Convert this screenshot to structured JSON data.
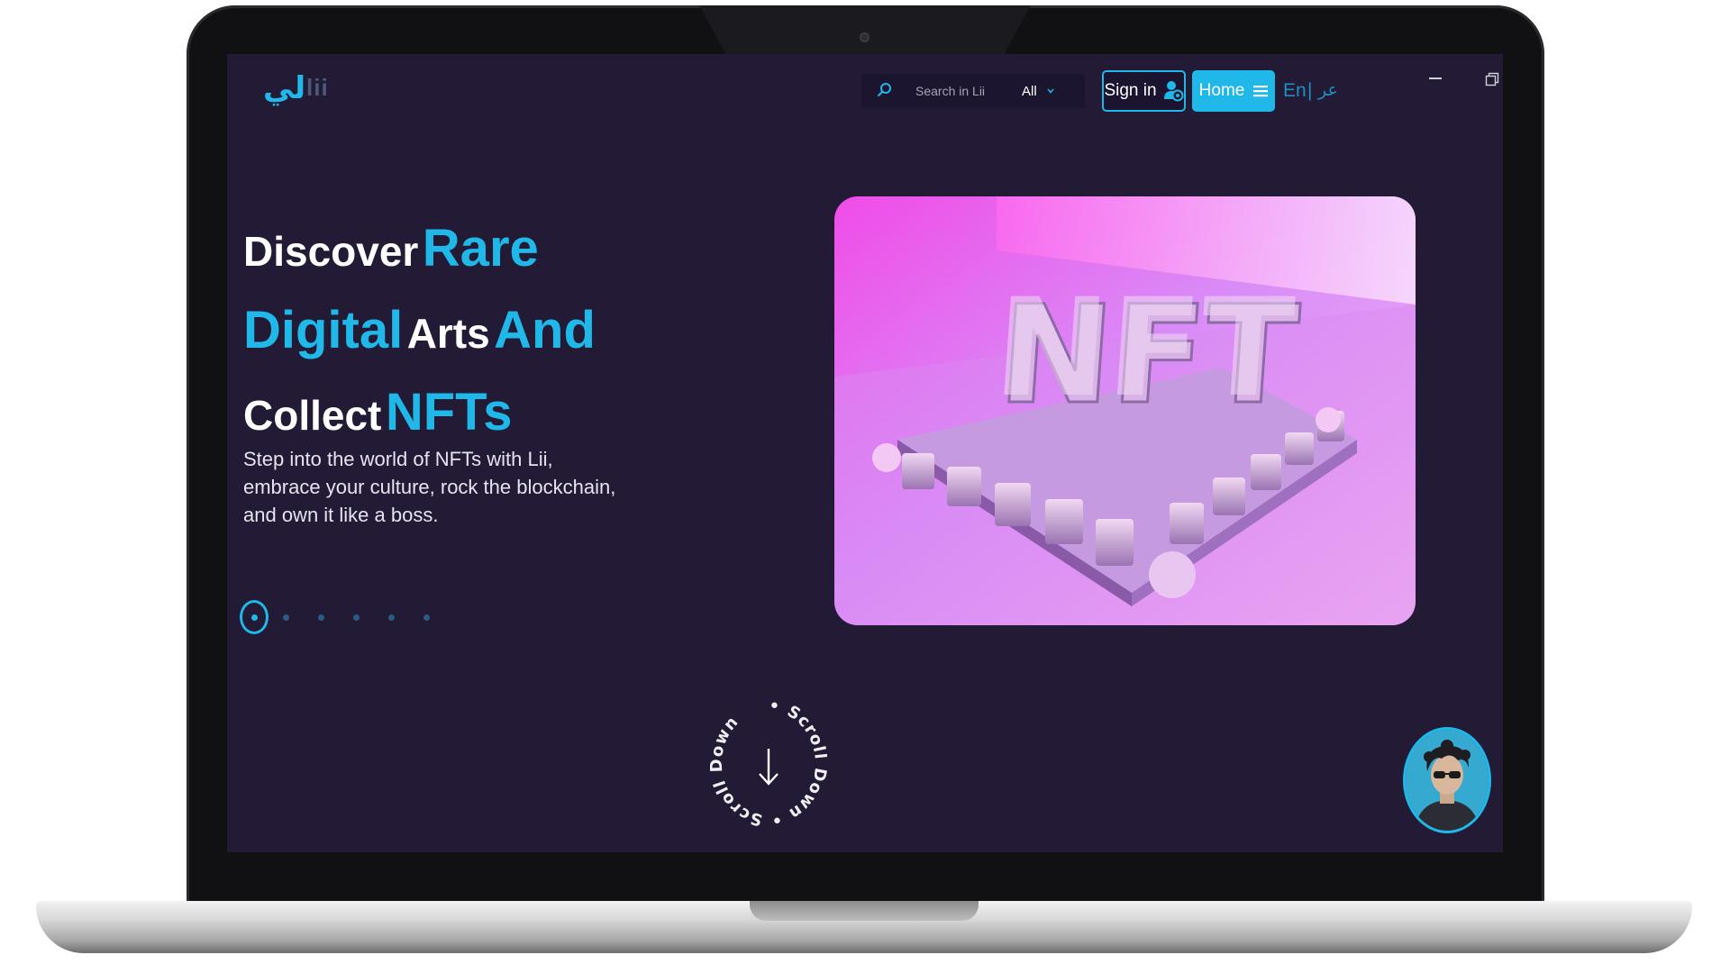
{
  "header": {
    "logo_arabic": "لي",
    "logo_latin": "lii",
    "search": {
      "placeholder": "Search in Lii",
      "value": ""
    },
    "scope_selected": "All",
    "signin_label": "Sign in",
    "home_label": "Home",
    "lang_en": "En",
    "lang_separator": "|",
    "lang_ar": "عر"
  },
  "hero": {
    "title_words": [
      "Discover",
      "Rare",
      "Digital",
      "Arts",
      "And",
      "Collect",
      "NFTs"
    ],
    "description": "Step into the world of NFTs with Lii, embrace your culture, rock the blockchain, and own it like a boss.",
    "image_text": "NFT",
    "slides": {
      "total": 6,
      "active": 1
    }
  },
  "scroll_badge": {
    "text": "• Scroll Down • Scroll Down",
    "icon": "arrow-down-icon"
  },
  "icons": [
    "search-icon",
    "chevron-down-icon",
    "user-icon",
    "menu-icon",
    "minimize-icon",
    "restore-icon",
    "arrow-down-icon"
  ],
  "colors": {
    "background": "#231a35",
    "accent": "#1fb8e8",
    "text": "#ffffff",
    "dot_inactive": "#2a5b86"
  }
}
